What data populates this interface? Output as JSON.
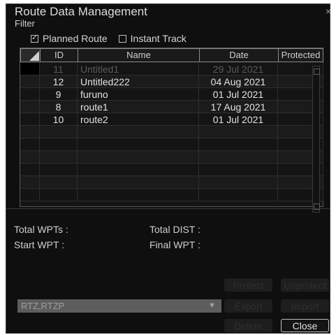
{
  "window": {
    "title": "Route Data Management",
    "close_glyph": "×"
  },
  "filter": {
    "label": "Filter",
    "options": [
      {
        "label": "Planned Route",
        "checked": true,
        "mark": "✓"
      },
      {
        "label": "Instant Track",
        "checked": false,
        "mark": ""
      }
    ]
  },
  "table": {
    "columns": [
      "ID",
      "Name",
      "Date",
      "Protected"
    ],
    "rows": [
      {
        "id": "11",
        "name": "Untitled1",
        "date": "29 Jul 2021",
        "protected": ""
      },
      {
        "id": "12",
        "name": "Untitled222",
        "date": "04 Aug 2021",
        "protected": ""
      },
      {
        "id": "9",
        "name": "furuno",
        "date": "01 Jul 2021",
        "protected": ""
      },
      {
        "id": "8",
        "name": "route1",
        "date": "17 Aug 2021",
        "protected": ""
      },
      {
        "id": "10",
        "name": "route2",
        "date": "01 Jul 2021",
        "protected": ""
      },
      {
        "id": "",
        "name": "",
        "date": "",
        "protected": ""
      },
      {
        "id": "",
        "name": "",
        "date": "",
        "protected": ""
      },
      {
        "id": "",
        "name": "",
        "date": "",
        "protected": ""
      },
      {
        "id": "",
        "name": "",
        "date": "",
        "protected": ""
      },
      {
        "id": "",
        "name": "",
        "date": "",
        "protected": ""
      },
      {
        "id": "",
        "name": "",
        "date": "",
        "protected": ""
      }
    ]
  },
  "info": {
    "total_wpts": "Total WPTs :",
    "total_dist": "Total DIST :",
    "start_wpt": "Start WPT :",
    "final_wpt": "Final WPT :"
  },
  "format_select": {
    "value": "RTZ,RTZP",
    "arrow": "▼"
  },
  "buttons": {
    "protect": "Protect",
    "unprotect": "Unprotect",
    "export": "Export",
    "import": "Import",
    "delete": "Delete",
    "close": "Close"
  }
}
